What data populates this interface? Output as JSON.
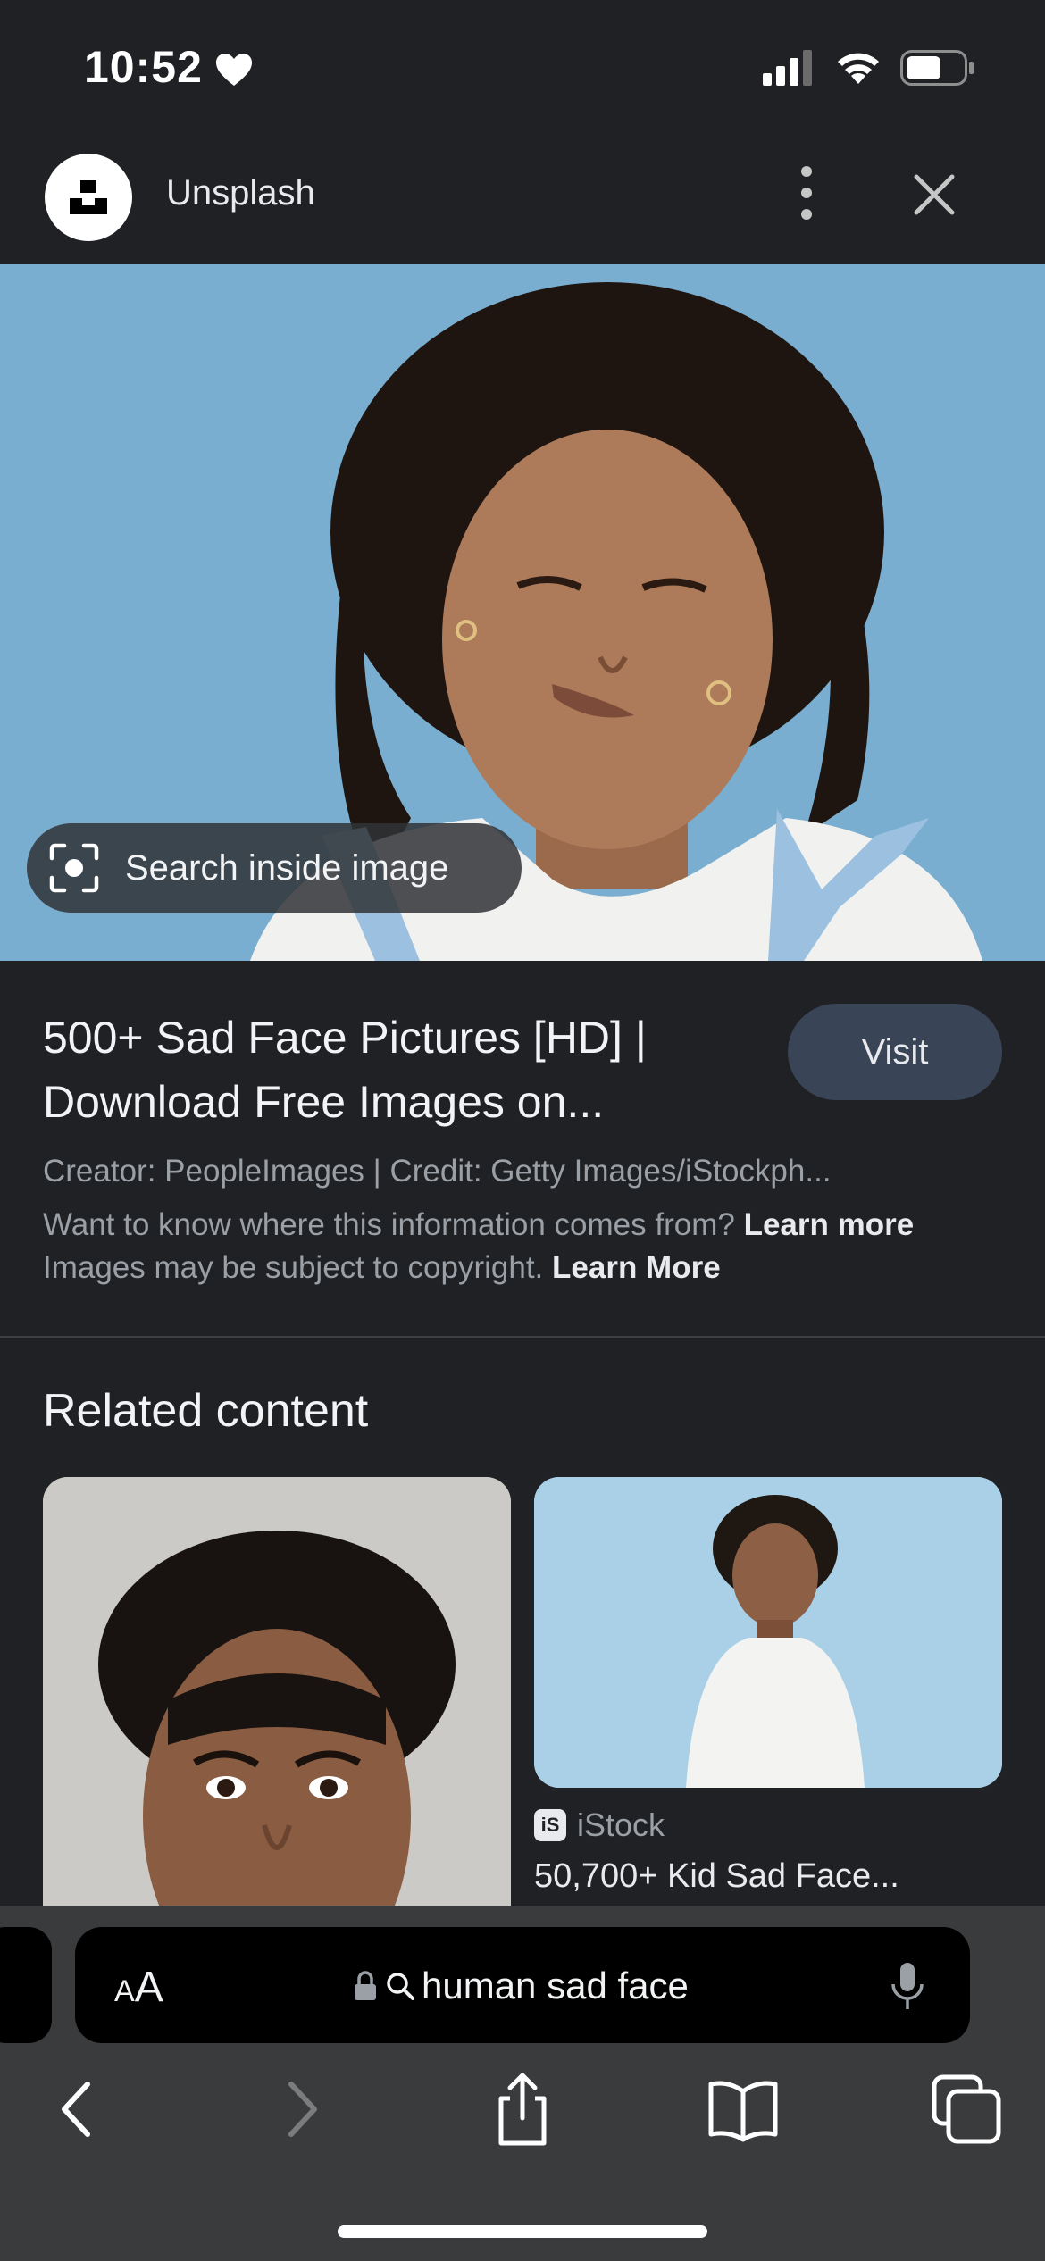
{
  "status_bar": {
    "time": "10:52",
    "icons": [
      "heart-icon",
      "cellular-signal-icon",
      "wifi-icon",
      "battery-icon"
    ]
  },
  "header": {
    "app_title": "Unsplash",
    "icons": [
      "unsplash-logo",
      "more-vert-icon",
      "close-icon"
    ]
  },
  "hero": {
    "search_inside_label": "Search inside image",
    "background_color": "#79aed0"
  },
  "result": {
    "title": "500+ Sad Face Pictures [HD] | Download Free Images on...",
    "visit_label": "Visit",
    "creator_line": "Creator: PeopleImages | Credit: Getty Images/iStockph...",
    "info_question": "Want to know where this information comes from?",
    "info_link": "Learn more",
    "copyright_text": "Images may be subject to copyright.",
    "copyright_link": "Learn More"
  },
  "related": {
    "heading": "Related content",
    "items": [
      {
        "image": "woman crying portrait"
      },
      {
        "image": "child in white t-shirt",
        "source": "iStock",
        "source_badge": "iS",
        "title": "50,700+ Kid Sad Face..."
      }
    ]
  },
  "browser": {
    "aa_label_small": "A",
    "aa_label_large": "A",
    "url": "human sad face",
    "toolbar": [
      "back-icon",
      "forward-icon",
      "share-icon",
      "bookmarks-icon",
      "tabs-icon"
    ]
  },
  "colors": {
    "background": "#202124",
    "visit_button": "#394457",
    "safari_bar": "#3a3b3d",
    "muted_text": "#9aa0a6"
  }
}
